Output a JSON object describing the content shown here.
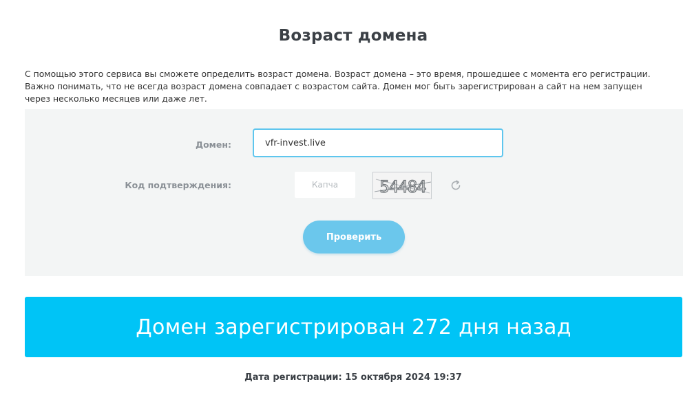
{
  "page": {
    "title": "Возраст домена",
    "intro": "С помощью этого сервиса вы сможете определить возраст домена. Возраст домена – это время, прошедшее с момента его регистрации. Важно понимать, что не всегда возраст домена совпадает с возрастом сайта. Домен мог быть зарегистрирован а сайт на нем запущен через несколько месяцев или даже лет."
  },
  "form": {
    "domain_label": "Домен:",
    "domain_value": "vfr-invest.live",
    "code_label": "Код подтверждения:",
    "captcha_placeholder": "Капча",
    "captcha_image_text": "54484",
    "refresh_icon": "refresh-icon",
    "submit_label": "Проверить"
  },
  "result": {
    "message": "Домен зарегистрирован 272 дня назад",
    "registration_date": "Дата регистрации: 15 октября 2024 19:37"
  },
  "colors": {
    "accent": "#00c4f6",
    "button": "#6bc7ec",
    "input_border": "#5ec6ee",
    "panel_bg": "#f3f5f5"
  }
}
